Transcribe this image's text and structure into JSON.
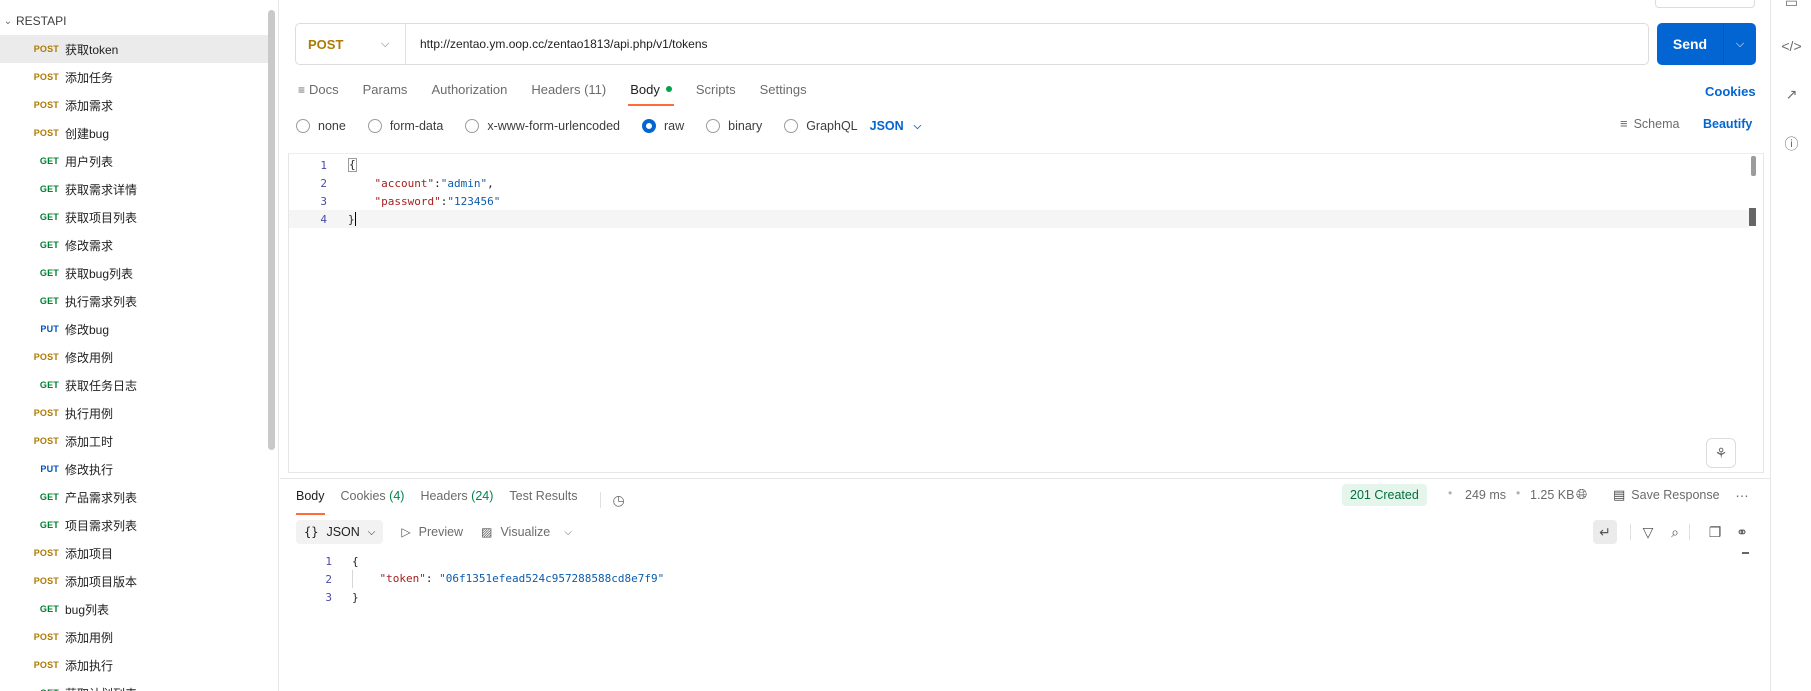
{
  "sidebar": {
    "collection_name": "RESTAPI",
    "items": [
      {
        "method": "POST",
        "name": "获取token",
        "active": true
      },
      {
        "method": "POST",
        "name": "添加任务"
      },
      {
        "method": "POST",
        "name": "添加需求"
      },
      {
        "method": "POST",
        "name": "创建bug"
      },
      {
        "method": "GET",
        "name": "用户列表"
      },
      {
        "method": "GET",
        "name": "获取需求详情"
      },
      {
        "method": "GET",
        "name": "获取项目列表"
      },
      {
        "method": "GET",
        "name": "修改需求"
      },
      {
        "method": "GET",
        "name": "获取bug列表"
      },
      {
        "method": "GET",
        "name": "执行需求列表"
      },
      {
        "method": "PUT",
        "name": "修改bug"
      },
      {
        "method": "POST",
        "name": "修改用例"
      },
      {
        "method": "GET",
        "name": "获取任务日志"
      },
      {
        "method": "POST",
        "name": "执行用例"
      },
      {
        "method": "POST",
        "name": "添加工时"
      },
      {
        "method": "PUT",
        "name": "修改执行"
      },
      {
        "method": "GET",
        "name": "产品需求列表"
      },
      {
        "method": "GET",
        "name": "项目需求列表"
      },
      {
        "method": "POST",
        "name": "添加项目"
      },
      {
        "method": "POST",
        "name": "添加项目版本"
      },
      {
        "method": "GET",
        "name": "bug列表"
      },
      {
        "method": "POST",
        "name": "添加用例"
      },
      {
        "method": "POST",
        "name": "添加执行"
      },
      {
        "method": "GET",
        "name": "获取计划列表"
      }
    ]
  },
  "request": {
    "method": "POST",
    "url": "http://zentao.ym.oop.cc/zentao1813/api.php/v1/tokens",
    "send_label": "Send",
    "tabs": [
      {
        "label": "Docs",
        "icon": "docs-icon"
      },
      {
        "label": "Params"
      },
      {
        "label": "Authorization"
      },
      {
        "label": "Headers (11)"
      },
      {
        "label": "Body",
        "active": true,
        "dot": true
      },
      {
        "label": "Scripts"
      },
      {
        "label": "Settings"
      }
    ],
    "cookies_label": "Cookies",
    "body_types": [
      {
        "label": "none"
      },
      {
        "label": "form-data"
      },
      {
        "label": "x-www-form-urlencoded"
      },
      {
        "label": "raw",
        "checked": true
      },
      {
        "label": "binary"
      },
      {
        "label": "GraphQL"
      }
    ],
    "raw_format": "JSON",
    "schema_label": "Schema",
    "beautify_label": "Beautify",
    "body_lines": [
      {
        "n": "1",
        "text": "{"
      },
      {
        "n": "2",
        "key": "\"account\"",
        "value": "\"admin\"",
        "trail": ","
      },
      {
        "n": "3",
        "key": "\"password\"",
        "value": "\"123456\"",
        "trail": ""
      },
      {
        "n": "4",
        "text": "}"
      }
    ]
  },
  "response": {
    "tabs": [
      {
        "label": "Body",
        "active": true
      },
      {
        "label": "Cookies",
        "count": "(4)"
      },
      {
        "label": "Headers",
        "count": "(24)"
      },
      {
        "label": "Test Results"
      }
    ],
    "status": "201 Created",
    "time": "249 ms",
    "size": "1.25 KB",
    "save_label": "Save Response",
    "format": "JSON",
    "preview_label": "Preview",
    "visualize_label": "Visualize",
    "lines": [
      {
        "n": "1",
        "text": "{"
      },
      {
        "n": "2",
        "key": "\"token\"",
        "value": "\"06f1351efead524c957288588cd8e7f9\""
      },
      {
        "n": "3",
        "text": "}"
      }
    ]
  },
  "colors": {
    "accent": "#0265d2",
    "post": "#ad7a03",
    "get": "#007f31",
    "put": "#0053b8",
    "tab_underline": "#ff6c37",
    "status_green": "#00703c"
  }
}
